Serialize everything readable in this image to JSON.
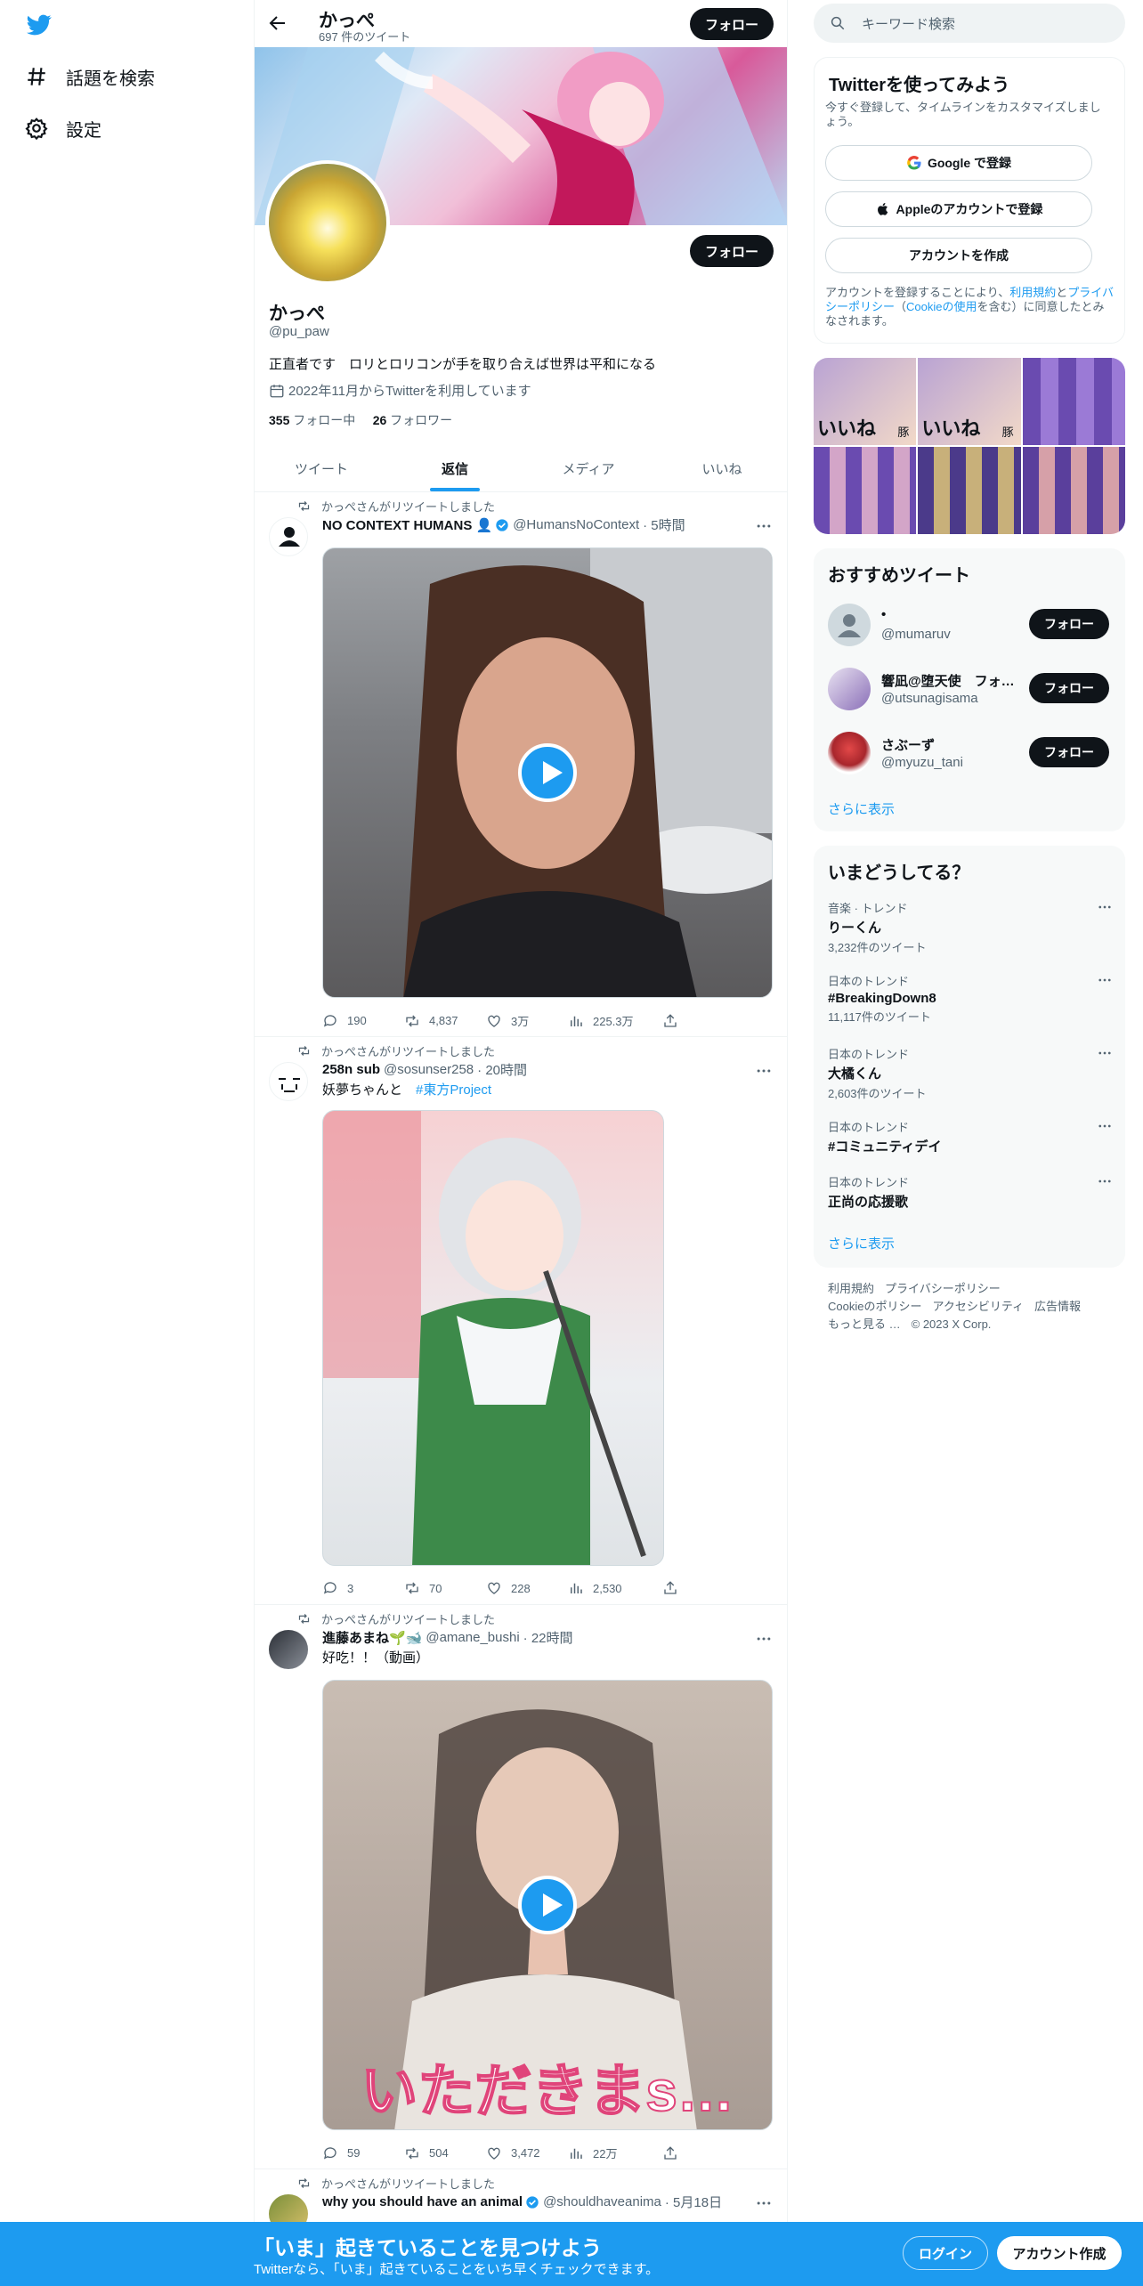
{
  "nav": {
    "items": [
      {
        "label": "話題を検索"
      },
      {
        "label": "設定"
      }
    ]
  },
  "header": {
    "name": "かっぺ",
    "tweet_count": "697 件のツイート",
    "follow_label": "フォロー"
  },
  "profile": {
    "name": "かっぺ",
    "handle": "@pu_paw",
    "bio": "正直者です　ロリとロリコンが手を取り合えば世界は平和になる",
    "joined": "2022年11月からTwitterを利用しています",
    "following_count": "355",
    "following_label": "フォロー中",
    "followers_count": "26",
    "followers_label": "フォロワー",
    "follow_label": "フォロー"
  },
  "tabs": [
    {
      "label": "ツイート"
    },
    {
      "label": "返信"
    },
    {
      "label": "メディア"
    },
    {
      "label": "いいね"
    }
  ],
  "tweets": [
    {
      "rt": "かっぺさんがリツイートしました",
      "name": "NO CONTEXT HUMANS 👤",
      "handle": "@HumansNoContext",
      "time": "· 5時間",
      "text": "",
      "replies": "190",
      "retweets": "4,837",
      "likes": "3万",
      "views": "225.3万"
    },
    {
      "rt": "かっぺさんがリツイートしました",
      "name": "258n sub",
      "handle": "@sosunser258",
      "time": "· 20時間",
      "text": "妖夢ちゃんと",
      "tag": "#東方Project",
      "replies": "3",
      "retweets": "70",
      "likes": "228",
      "views": "2,530"
    },
    {
      "rt": "かっぺさんがリツイートしました",
      "name": "進藤あまね🌱🐋",
      "handle": "@amane_bushi",
      "time": "· 22時間",
      "text": "好吃！！（動画）",
      "caption": "いただきまs…",
      "replies": "59",
      "retweets": "504",
      "likes": "3,472",
      "views": "22万"
    },
    {
      "rt": "かっぺさんがリツイートしました",
      "name": "why you should have an animal",
      "handle": "@shouldhaveanima",
      "time": "· 5月18日"
    }
  ],
  "search": {
    "placeholder": "キーワード検索"
  },
  "signup": {
    "title": "Twitterを使ってみよう",
    "subtitle": "今すぐ登録して、タイムラインをカスタマイズしましょう。",
    "google": "Google で登録",
    "apple": "Appleのアカウントで登録",
    "create": "アカウントを作成",
    "terms_pre": "アカウントを登録することにより、",
    "terms_link": "利用規約",
    "terms_and": "と",
    "privacy_link": "プライバシーポリシー",
    "cookie_pre": "（",
    "cookie_link": "Cookieの使用",
    "terms_post": "を含む）に同意したとみなされます。"
  },
  "media_grid": {
    "labels": [
      "いいね",
      "豚",
      "いいね",
      "豚"
    ]
  },
  "who_to_follow": {
    "title": "おすすめツイート",
    "users": [
      {
        "name": "•",
        "handle": "@mumaruv"
      },
      {
        "name": "響凪@堕天使　フォ…",
        "handle": "@utsunagisama"
      },
      {
        "name": "さぶーず",
        "handle": "@myuzu_tani"
      }
    ],
    "follow_label": "フォロー",
    "more": "さらに表示"
  },
  "trends": {
    "title": "いまどうしてる？",
    "items": [
      {
        "meta": "音楽 · トレンド",
        "name": "りーくん",
        "count": "3,232件のツイート"
      },
      {
        "meta": "日本のトレンド",
        "name": "#BreakingDown8",
        "count": "11,117件のツイート"
      },
      {
        "meta": "日本のトレンド",
        "name": "大橘くん",
        "count": "2,603件のツイート"
      },
      {
        "meta": "日本のトレンド",
        "name": "#コミュニティデイ",
        "count": ""
      },
      {
        "meta": "日本のトレンド",
        "name": "正尚の応援歌",
        "count": ""
      }
    ],
    "more": "さらに表示"
  },
  "footer": {
    "terms": "利用規約",
    "privacy": "プライバシーポリシー",
    "cookie": "Cookieのポリシー",
    "accessibility": "アクセシビリティ",
    "ads": "広告情報",
    "more": "もっと見る …",
    "copyright": "© 2023 X Corp."
  },
  "bottom_bar": {
    "title": "「いま」起きていることを見つけよう",
    "subtitle": "Twitterなら、「いま」起きていることをいち早くチェックできます。",
    "login": "ログイン",
    "signup": "アカウント作成"
  },
  "colors": {
    "accent": "#1d9bf0",
    "text": "#0f1419",
    "muted": "#536471"
  }
}
